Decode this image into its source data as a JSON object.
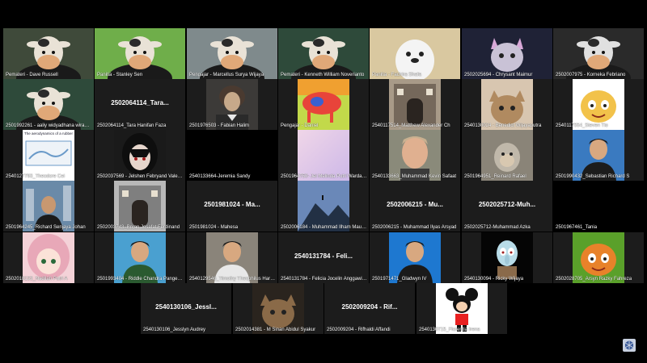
{
  "tiles": [
    {
      "caption": "Pemateri - Dave Russell",
      "kind": "video",
      "icon": "cow-avatar",
      "bg": "#3f4a3a",
      "accent": "#e9e2d6"
    },
    {
      "caption": "Panitia - Stanley Sen",
      "kind": "video",
      "icon": "cow-avatar",
      "bg": "#6fae4a",
      "accent": "#e9e2d6"
    },
    {
      "caption": "Pengajar - Marcellus Surya Wijaya",
      "kind": "video",
      "icon": "cow-avatar",
      "bg": "#7f8a8c",
      "accent": "#e9e2d6"
    },
    {
      "caption": "Pemateri - Kenneth William Noverianto",
      "kind": "video",
      "icon": "cow-avatar",
      "bg": "#2e4a3a",
      "accent": "#e9e2d6"
    },
    {
      "caption": "Panitia - Fachira Shafa",
      "kind": "video",
      "icon": "seal-avatar",
      "bg": "#d9c8a0",
      "accent": "#ffffff"
    },
    {
      "caption": "2502025694 - Chrysant Maimur",
      "kind": "video",
      "icon": "cat-avatar",
      "bg": "#1f2236",
      "accent": "#c9c2d6"
    },
    {
      "caption": "2502007975 - Korneka Febriano",
      "kind": "video",
      "icon": "cow-avatar",
      "bg": "#2a2a2a",
      "accent": "#e0e0e0"
    },
    {
      "caption": "2501992261 - aaliy widyadhana wirawan",
      "kind": "video",
      "icon": "cow-avatar",
      "bg": "#2e4a3a",
      "accent": "#e9e2d6"
    },
    {
      "caption": "2502064114_Tara Hanifan Faza",
      "kind": "name",
      "big": "2502064114_Tara..."
    },
    {
      "caption": "2501976503 - Fabian Halim",
      "kind": "photo",
      "icon": "portrait-avatar",
      "bg": "#3c3a38",
      "accent": "#c7a98a"
    },
    {
      "caption": "Pengajar - Daniel",
      "kind": "photo",
      "icon": "cow-heatmap-avatar",
      "bg": "#c2d94a",
      "accent": "#e8443a"
    },
    {
      "caption": "2540117514_Matthew Alexander Ch",
      "kind": "photo",
      "icon": "building-avatar",
      "bg": "#a89a88",
      "accent": "#4a4036"
    },
    {
      "caption": "2540130024 - Benedict Wijayaputra",
      "kind": "photo",
      "icon": "cat-photo-avatar",
      "bg": "#d8c6b0",
      "accent": "#b08a60"
    },
    {
      "caption": "2540117554_Steven Tio",
      "kind": "photo",
      "icon": "cartoon-avatar",
      "bg": "#ffffff",
      "accent": "#f2c24a"
    },
    {
      "caption": "2540127793_Theodore Cei",
      "kind": "photo",
      "icon": "document-avatar",
      "bg": "#ffffff",
      "accent": "#6a9ac9",
      "label": "The aerodynamics of a rubber"
    },
    {
      "caption": "2502037569 - Jelshen Febryand Valesco",
      "kind": "photo",
      "icon": "anime-avatar",
      "bg": "#1a1a1a",
      "accent": "#e6d6cc"
    },
    {
      "caption": "2540133664-Jeremia Sandy",
      "kind": "black"
    },
    {
      "caption": "2501964750- Jei Melinda Putri Wardana",
      "kind": "photo",
      "icon": "pastel-avatar",
      "bg": "#f0d6e8",
      "accent": "#cdb8e8"
    },
    {
      "caption": "2540133663_Muhammad Kevin Safaat",
      "kind": "photo",
      "icon": "face-avatar",
      "bg": "#8a8a7a",
      "accent": "#e0b090"
    },
    {
      "caption": "2501964951_Reinard Rafael",
      "kind": "photo",
      "icon": "monkey-avatar",
      "bg": "#8a8478",
      "accent": "#c0b8aa"
    },
    {
      "caption": "2501990432_Sebastian Richard S",
      "kind": "photo",
      "icon": "person-avatar",
      "bg": "#3a7ac0",
      "accent": "#1c1c1c"
    },
    {
      "caption": "2501964245_Richard Senjaya Johan",
      "kind": "photo",
      "icon": "city-avatar",
      "bg": "#6a8aa8",
      "accent": "#1a1a1a"
    },
    {
      "caption": "2502003743_Bryan Josafat Ferdinand",
      "kind": "photo",
      "icon": "building-avatar",
      "bg": "#b8b8b8",
      "accent": "#505050"
    },
    {
      "caption": "2501981024 - Mahesa",
      "kind": "name",
      "big": "2501981024 - Ma..."
    },
    {
      "caption": "2502006184 - Muhammad Ilham Maulana",
      "kind": "photo",
      "icon": "mountain-avatar",
      "bg": "#6a88b8",
      "accent": "#223044"
    },
    {
      "caption": "2502006215 - Muhammad Ilyas Arsyad",
      "kind": "name",
      "big": "2502006215 - Mu..."
    },
    {
      "caption": "2502025712-Muhammad Azka",
      "kind": "name",
      "big": "2502025712-Muh..."
    },
    {
      "caption": "2501967461_Tania",
      "kind": "black"
    },
    {
      "caption": "2502018153_Nadilah Putri A",
      "kind": "photo",
      "icon": "anime-pink-avatar",
      "bg": "#f4d2d8",
      "accent": "#e8a8b8"
    },
    {
      "caption": "2501993404 - Riddle Chandra Pangestu",
      "kind": "photo",
      "icon": "person-avatar",
      "bg": "#4aa0d0",
      "accent": "#2a5a30"
    },
    {
      "caption": "2540129546_Timothy Theophilus Hartono",
      "kind": "photo",
      "icon": "person-avatar",
      "bg": "#8a847a",
      "accent": "#e8e8e8"
    },
    {
      "caption": "2540131784 - Felicia Jocelin Anggawijaya",
      "kind": "name",
      "big": "2540131784 - Feli..."
    },
    {
      "caption": "2501971471_Gladwyn IV",
      "kind": "photo",
      "icon": "person-avatar",
      "bg": "#1e78d0",
      "accent": "#1a1a1a"
    },
    {
      "caption": "2540130094 - Ricky Wijaya",
      "kind": "photo",
      "icon": "squid-avatar",
      "bg": "#050505",
      "accent": "#b8dce8"
    },
    {
      "caption": "2502028705_Arsyn Razky Fahreza",
      "kind": "photo",
      "icon": "cartoon-avatar",
      "bg": "#5aa02a",
      "accent": "#e8822a"
    },
    {
      "caption": "2540130106_Jesslyn Audrey",
      "kind": "name",
      "big": "2540130106_Jessl..."
    },
    {
      "caption": "2502014381 - M Sinan Abidul Syakur",
      "kind": "photo",
      "icon": "cat-photo-avatar",
      "bg": "#2a241e",
      "accent": "#8a6a48"
    },
    {
      "caption": "2502009204 - Rifhaldi Affandi",
      "kind": "name",
      "big": "2502009204 - Rif..."
    },
    {
      "caption": "2540130715_Florentia Irena",
      "kind": "photo",
      "icon": "mickey-avatar",
      "bg": "#ffffff",
      "accent": "#e82020"
    }
  ],
  "fullscreen_icon": "fullscreen-icon"
}
